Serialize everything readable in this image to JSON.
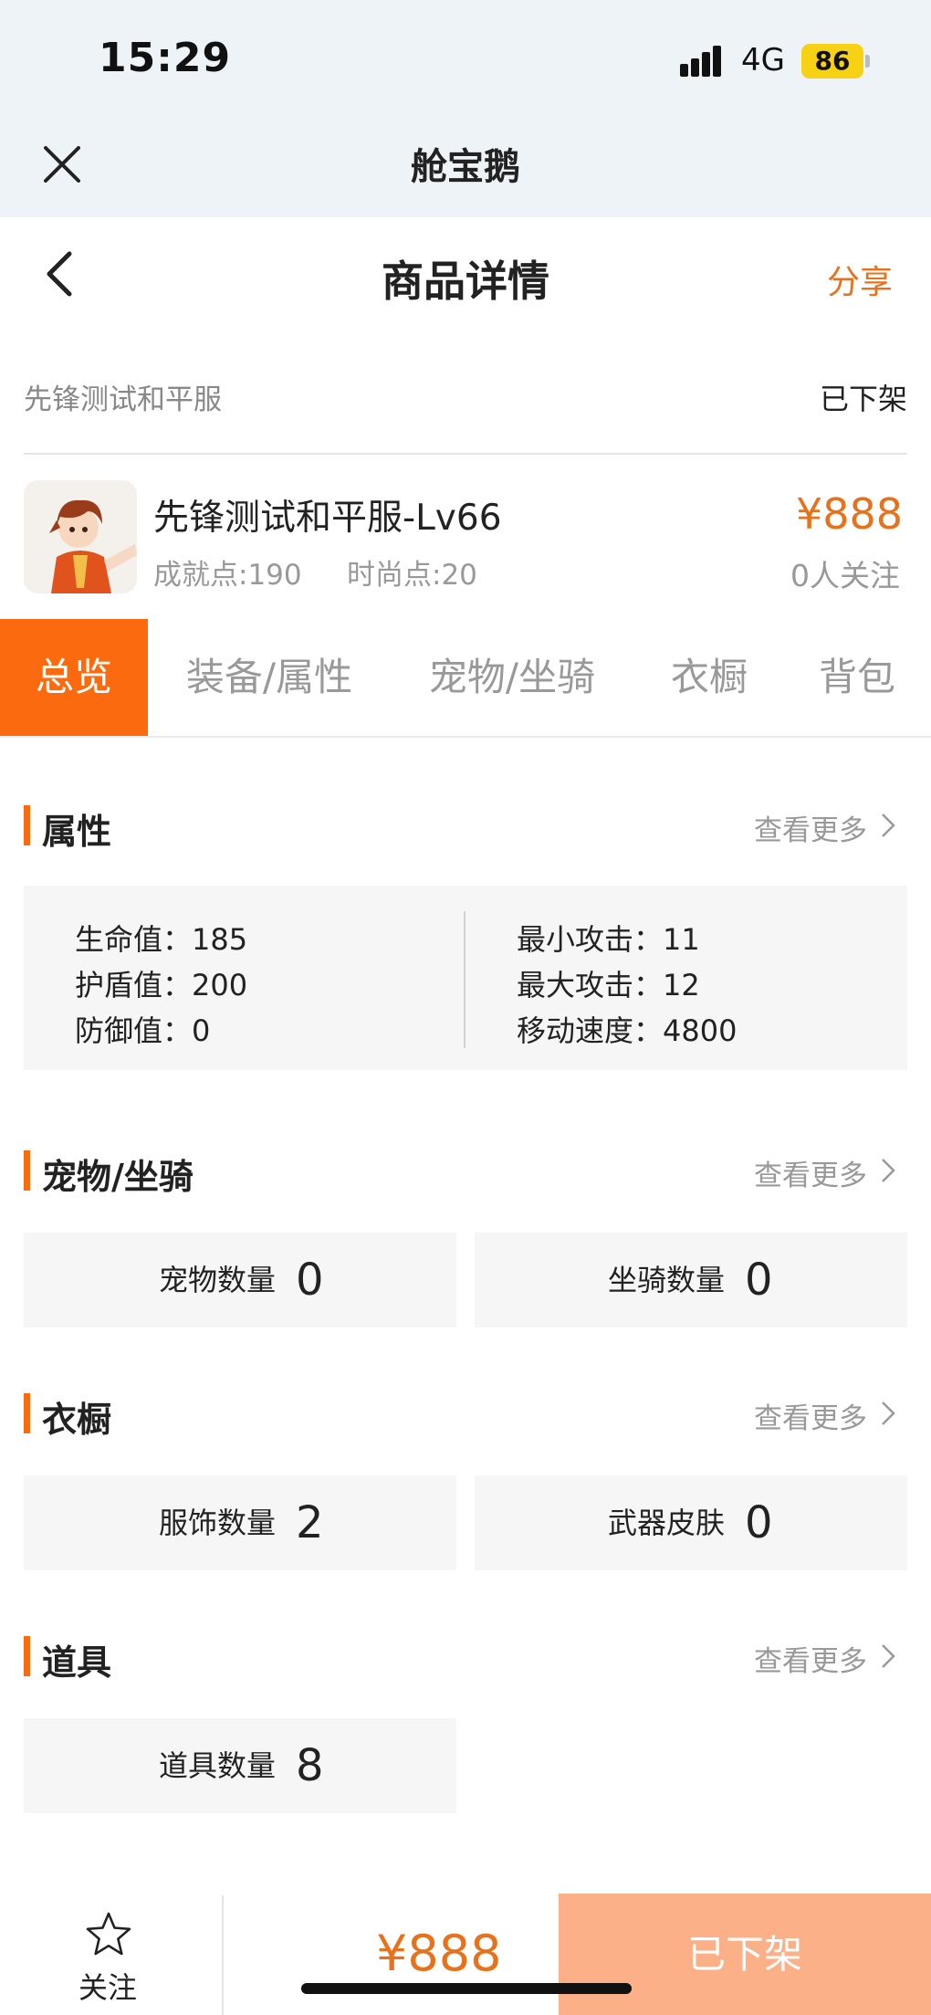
{
  "status_bar": {
    "time": "15:29",
    "network": "4G",
    "battery": "86"
  },
  "mini_app": {
    "title": "舱宝鹅"
  },
  "header": {
    "title": "商品详情",
    "share_label": "分享"
  },
  "account": {
    "name": "先锋测试和平服",
    "status": "已下架"
  },
  "product": {
    "title": "先锋测试和平服-Lv66",
    "achievement": "成就点:190",
    "fashion": "时尚点:20",
    "price": "¥888",
    "followers": "0人关注"
  },
  "tabs": [
    "总览",
    "装备/属性",
    "宠物/坐骑",
    "衣橱",
    "背包"
  ],
  "more_label": "查看更多",
  "attributes": {
    "title": "属性",
    "left": [
      "生命值：185",
      "护盾值：200",
      "防御值：0"
    ],
    "right": [
      "最小攻击：11",
      "最大攻击：12",
      "移动速度：4800"
    ]
  },
  "pets": {
    "title": "宠物/坐骑",
    "cards": [
      {
        "label": "宠物数量",
        "value": "0"
      },
      {
        "label": "坐骑数量",
        "value": "0"
      }
    ]
  },
  "wardrobe": {
    "title": "衣橱",
    "cards": [
      {
        "label": "服饰数量",
        "value": "2"
      },
      {
        "label": "武器皮肤",
        "value": "0"
      }
    ]
  },
  "items": {
    "title": "道具",
    "cards": [
      {
        "label": "道具数量",
        "value": "8"
      }
    ]
  },
  "bottom_bar": {
    "follow_label": "关注",
    "price": "¥888",
    "button_label": "已下架"
  },
  "colors": {
    "accent": "#fb6a0f",
    "price": "#e8721b",
    "disabled_button": "#fcb088",
    "top_bg": "#edf3f6"
  }
}
